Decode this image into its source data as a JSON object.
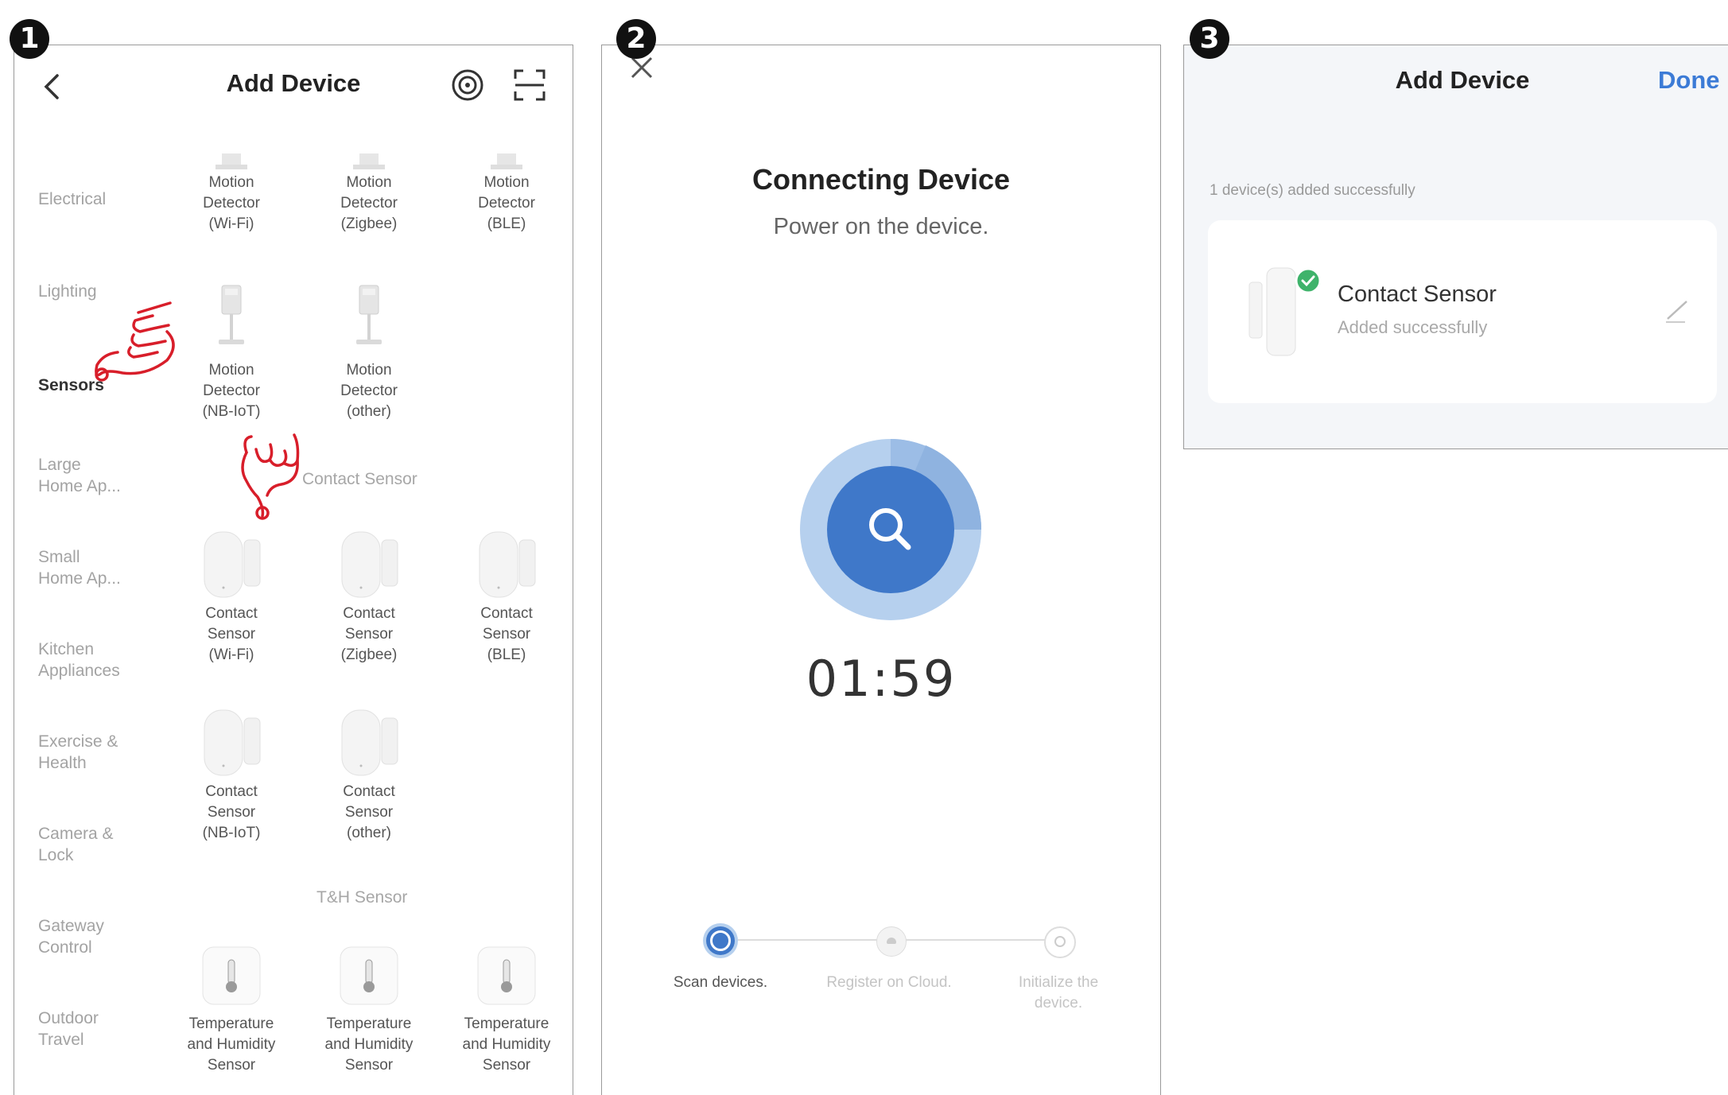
{
  "step_badges": [
    "1",
    "2",
    "3"
  ],
  "screen1": {
    "title": "Add Device",
    "categories": [
      {
        "label": "Electrical",
        "active": false
      },
      {
        "label": "Lighting",
        "active": false
      },
      {
        "label": "Sensors",
        "active": true
      },
      {
        "label": "Large\nHome Ap...",
        "active": false
      },
      {
        "label": "Small\nHome Ap...",
        "active": false
      },
      {
        "label": "Kitchen\nAppliances",
        "active": false
      },
      {
        "label": "Exercise &\nHealth",
        "active": false
      },
      {
        "label": "Camera &\nLock",
        "active": false
      },
      {
        "label": "Gateway\nControl",
        "active": false
      },
      {
        "label": "Outdoor\nTravel",
        "active": false
      }
    ],
    "motion_row1": [
      "Motion\nDetector\n(Wi-Fi)",
      "Motion\nDetector\n(Zigbee)",
      "Motion\nDetector\n(BLE)"
    ],
    "motion_row2": [
      "Motion\nDetector\n(NB-IoT)",
      "Motion\nDetector\n(other)"
    ],
    "contact_section": "Contact Sensor",
    "contact_row1": [
      "Contact\nSensor\n(Wi-Fi)",
      "Contact\nSensor\n(Zigbee)",
      "Contact\nSensor\n(BLE)"
    ],
    "contact_row2": [
      "Contact\nSensor\n(NB-IoT)",
      "Contact\nSensor\n(other)"
    ],
    "th_section": "T&H Sensor",
    "th_row": [
      "Temperature\nand Humidity\nSensor",
      "Temperature\nand Humidity\nSensor",
      "Temperature\nand Humidity\nSensor"
    ],
    "accent_color": "#d81e2a"
  },
  "screen2": {
    "title": "Connecting Device",
    "subtitle": "Power on the device.",
    "timer": "01:59",
    "steps": [
      {
        "label": "Scan\ndevices.",
        "state": "active"
      },
      {
        "label": "Register on\nCloud.",
        "state": "pending"
      },
      {
        "label": "Initialize the\ndevice.",
        "state": "pending"
      }
    ],
    "accent_color": "#3f78c9"
  },
  "screen3": {
    "title": "Add Device",
    "done_label": "Done",
    "info": "1 device(s) added successfully",
    "device_name": "Contact Sensor",
    "device_status": "Added successfully",
    "success_color": "#3fb36b"
  }
}
